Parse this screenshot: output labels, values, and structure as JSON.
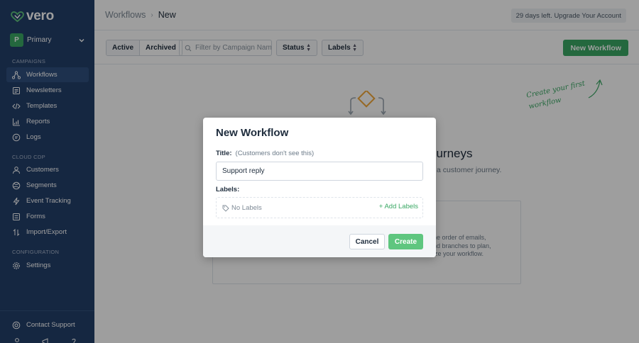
{
  "app": {
    "name": "vero",
    "brand_color": "#3aa864",
    "sidebar_color": "#233f6a"
  },
  "workspace": {
    "initial": "P",
    "name": "Primary"
  },
  "sidebar": {
    "campaigns_label": "CAMPAIGNS",
    "campaigns": [
      {
        "label": "Workflows",
        "icon": "workflow-icon",
        "active": true
      },
      {
        "label": "Newsletters",
        "icon": "newsletter-icon"
      },
      {
        "label": "Templates",
        "icon": "code-icon"
      },
      {
        "label": "Reports",
        "icon": "reports-icon"
      },
      {
        "label": "Logs",
        "icon": "logs-icon"
      }
    ],
    "cdp_label": "CLOUD CDP",
    "cdp": [
      {
        "label": "Customers",
        "icon": "customers-icon"
      },
      {
        "label": "Segments",
        "icon": "segments-icon"
      },
      {
        "label": "Event Tracking",
        "icon": "lightning-icon"
      },
      {
        "label": "Forms",
        "icon": "forms-icon"
      },
      {
        "label": "Import/Export",
        "icon": "import-export-icon"
      }
    ],
    "config_label": "CONFIGURATION",
    "config": [
      {
        "label": "Settings",
        "icon": "gear-icon"
      }
    ],
    "support": {
      "label": "Contact Support",
      "icon": "support-icon"
    }
  },
  "header": {
    "breadcrumb_parent": "Workflows",
    "breadcrumb_current": "New",
    "trial_text": "29 days left. Upgrade Your Account"
  },
  "toolbar": {
    "tab_active": "Active",
    "tab_archived": "Archived",
    "filter_placeholder": "Filter by Campaign Name",
    "status_select": "Status",
    "labels_select": "Labels",
    "new_workflow": "New Workflow"
  },
  "empty_state": {
    "hint_line1": "Create your first",
    "hint_line2": "workflow",
    "title_fragment": "ourneys",
    "subtitle_fragment": "a customer journey.",
    "card_line1": "he order of emails,",
    "card_line2": "nd branches to plan,",
    "card_line3": "ize your workflow."
  },
  "modal": {
    "title": "New Workflow",
    "title_label": "Title:",
    "title_note": "(Customers don't see this)",
    "title_value": "Support reply",
    "labels_label": "Labels:",
    "no_labels": "No Labels",
    "add_labels": "+ Add Labels",
    "cancel": "Cancel",
    "create": "Create"
  }
}
